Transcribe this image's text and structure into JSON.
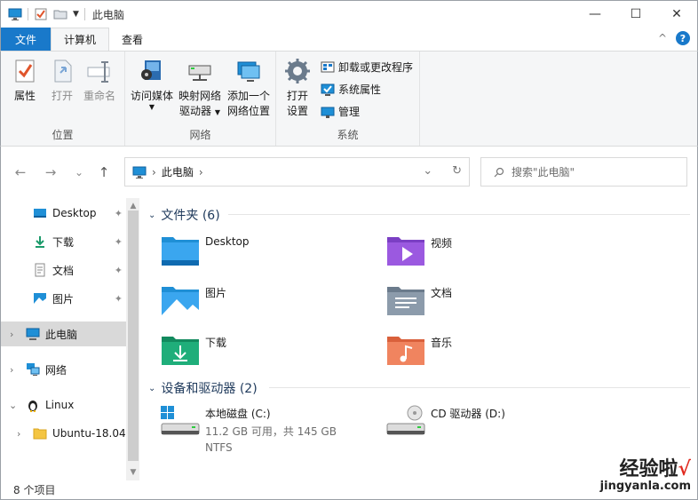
{
  "window": {
    "title": "此电脑",
    "controls": {
      "minimize": "—",
      "maximize": "☐",
      "close": "✕"
    }
  },
  "ribbon": {
    "tabs": [
      {
        "label": "文件",
        "kind": "file"
      },
      {
        "label": "计算机",
        "kind": "active"
      },
      {
        "label": "查看",
        "kind": "normal"
      }
    ],
    "collapse_glyph": "^",
    "help_glyph": "?",
    "groups": {
      "location": {
        "label": "位置",
        "buttons": [
          {
            "label": "属性"
          },
          {
            "label": "打开"
          },
          {
            "label": "重命名"
          }
        ]
      },
      "network": {
        "label": "网络",
        "buttons": [
          {
            "label": "访问媒体"
          },
          {
            "label_line1": "映射网络",
            "label_line2": "驱动器"
          },
          {
            "label_line1": "添加一个",
            "label_line2": "网络位置"
          }
        ]
      },
      "system": {
        "label": "系统",
        "open_settings": {
          "label_line1": "打开",
          "label_line2": "设置"
        },
        "small": [
          {
            "label": "卸载或更改程序"
          },
          {
            "label": "系统属性"
          },
          {
            "label": "管理"
          }
        ]
      }
    }
  },
  "nav": {
    "back": "←",
    "forward": "→",
    "recent": "⌄",
    "up": "↑",
    "address": {
      "crumb": "此电脑",
      "separator": "›"
    },
    "dropdown_glyph": "⌄",
    "refresh_glyph": "↻",
    "search_placeholder": "搜索\"此电脑\""
  },
  "sidebar": {
    "items": [
      {
        "label": "Desktop",
        "pinned": true
      },
      {
        "label": "下载",
        "pinned": true
      },
      {
        "label": "文档",
        "pinned": true
      },
      {
        "label": "图片",
        "pinned": true
      },
      {
        "label": "此电脑",
        "selected": true
      },
      {
        "label": "网络"
      },
      {
        "label": "Linux",
        "expanded": true
      },
      {
        "label": "Ubuntu-18.04"
      }
    ],
    "pin_glyph": "📌"
  },
  "content": {
    "folders_header": "文件夹 (6)",
    "folders": [
      {
        "name": "Desktop"
      },
      {
        "name": "视频"
      },
      {
        "name": "图片"
      },
      {
        "name": "文档"
      },
      {
        "name": "下载"
      },
      {
        "name": "音乐"
      }
    ],
    "drives_header": "设备和驱动器 (2)",
    "drives": [
      {
        "name": "本地磁盘 (C:)",
        "space": "11.2 GB 可用，共 145 GB",
        "fs": "NTFS"
      },
      {
        "name": "CD 驱动器 (D:)"
      }
    ]
  },
  "status": {
    "item_count": "8 个项目"
  },
  "watermark": {
    "title": "经验啦",
    "check": "√",
    "url": "jingyanla.com"
  },
  "colors": {
    "accent": "#1979ca",
    "ribbon_bg": "#f5f6f7",
    "section_header": "#1e395b",
    "selected_bg": "#d9d9d9"
  }
}
